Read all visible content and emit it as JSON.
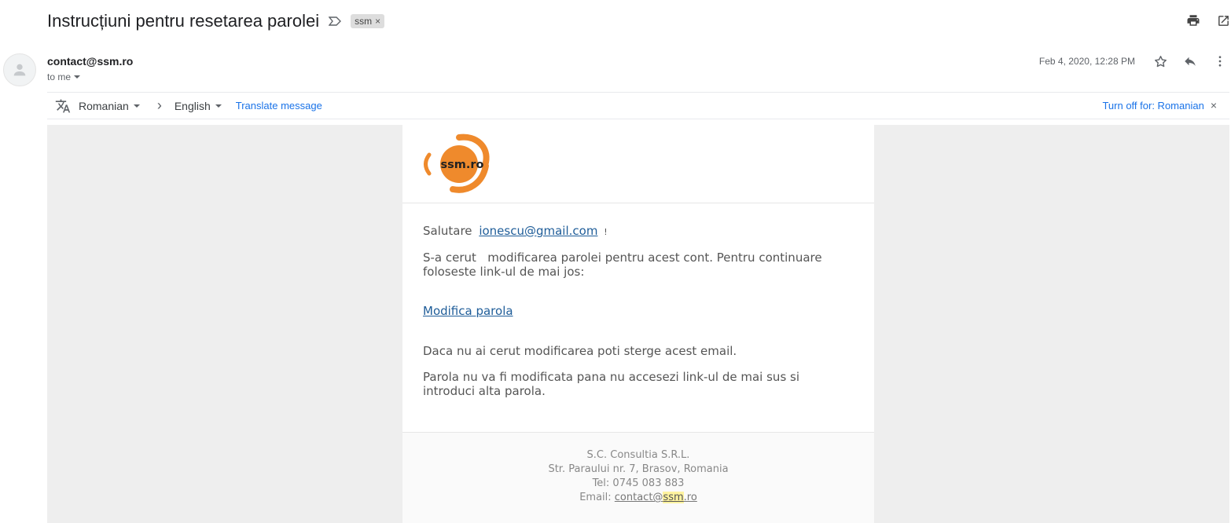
{
  "subject": "Instrucțiuni pentru resetarea parolei",
  "label": {
    "text": "ssm",
    "remove": "×"
  },
  "sender": {
    "email": "contact@ssm.ro",
    "to": "to me"
  },
  "date": "Feb 4, 2020, 12:28 PM",
  "translate_bar": {
    "source_lang": "Romanian",
    "arrow": "›",
    "target_lang": "English",
    "translate_link": "Translate message",
    "turn_off": "Turn off for: Romanian",
    "close": "×"
  },
  "email": {
    "logo_text": "ssm.ro",
    "greeting": "Salutare",
    "greeting_email": "ionescu@gmail.com",
    "greeting_end": "!",
    "para1_a": "S-a cerut",
    "para1_b": "modificarea parolei pentru acest cont. Pentru continuare foloseste link-ul de mai jos:",
    "reset_link": "Modifica parola",
    "para2": "Daca nu ai cerut modificarea poti sterge acest email.",
    "para3": "Parola nu va fi modificata pana nu accesezi link-ul de mai sus si introduci alta parola.",
    "footer": {
      "company": "S.C. Consultia S.R.L.",
      "address": "Str. Paraului nr. 7, Brasov, Romania",
      "tel": "Tel: 0745 083 883",
      "email_label": "Email: ",
      "email_user": "contact@",
      "email_domain_hl": "ssm",
      "email_tld": ".ro"
    }
  },
  "colors": {
    "accent": "#1a73e8",
    "logo_orange": "#ef8a2c",
    "email_link": "#1f5d99"
  },
  "icons": [
    "important-marker-icon",
    "print-icon",
    "open-in-new-window-icon",
    "person-avatar-icon",
    "star-icon",
    "reply-icon",
    "more-vert-icon",
    "translate-icon",
    "chevron-right-icon"
  ]
}
